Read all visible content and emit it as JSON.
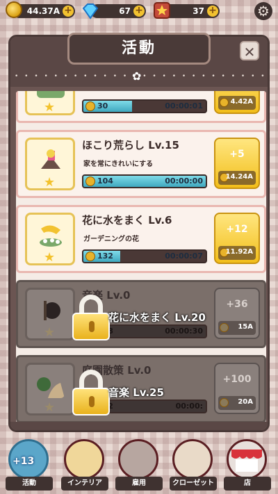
{
  "topbar": {
    "coins": "44.37A",
    "gems": "67",
    "tickets": "37"
  },
  "panel": {
    "title": "活動",
    "close_glyph": "✕"
  },
  "activities": [
    {
      "name": "",
      "description": "",
      "count": "30",
      "time": "00:00:01",
      "gain": "",
      "cost": "4.42A",
      "progress": 0.4,
      "locked": false
    },
    {
      "name": "ほこり荒らし Lv.15",
      "description": "家を常にきれいにする",
      "count": "104",
      "time": "00:00:00",
      "gain": "+5",
      "cost": "14.24A",
      "progress": 1.0,
      "locked": false
    },
    {
      "name": "花に水をまく Lv.6",
      "description": "ガーデニングの花",
      "count": "132",
      "time": "00:00:07",
      "gain": "+12",
      "cost": "11.92A",
      "progress": 0.3,
      "locked": false
    },
    {
      "name": "音楽 Lv.0",
      "description": "",
      "count": "198",
      "time": "00:00:30",
      "gain": "+36",
      "cost": "15A",
      "progress": 0,
      "locked": true,
      "unlock": "花に水をまく Lv.20"
    },
    {
      "name": "庭園散策 Lv.0",
      "description": "",
      "count": "552",
      "time": "00:00:",
      "gain": "+100",
      "cost": "20A",
      "progress": 0,
      "locked": true,
      "unlock": "音楽 Lv.25"
    }
  ],
  "nav": [
    {
      "label": "活動",
      "badge": "+13"
    },
    {
      "label": "インテリア",
      "badge": ""
    },
    {
      "label": "雇用",
      "badge": ""
    },
    {
      "label": "クローゼット",
      "badge": ""
    },
    {
      "label": "店",
      "badge": ""
    }
  ],
  "colors": {
    "accent_gold": "#f2be1a",
    "progress_cyan": "#3fa8bf",
    "panel_brown": "#6b5552"
  }
}
